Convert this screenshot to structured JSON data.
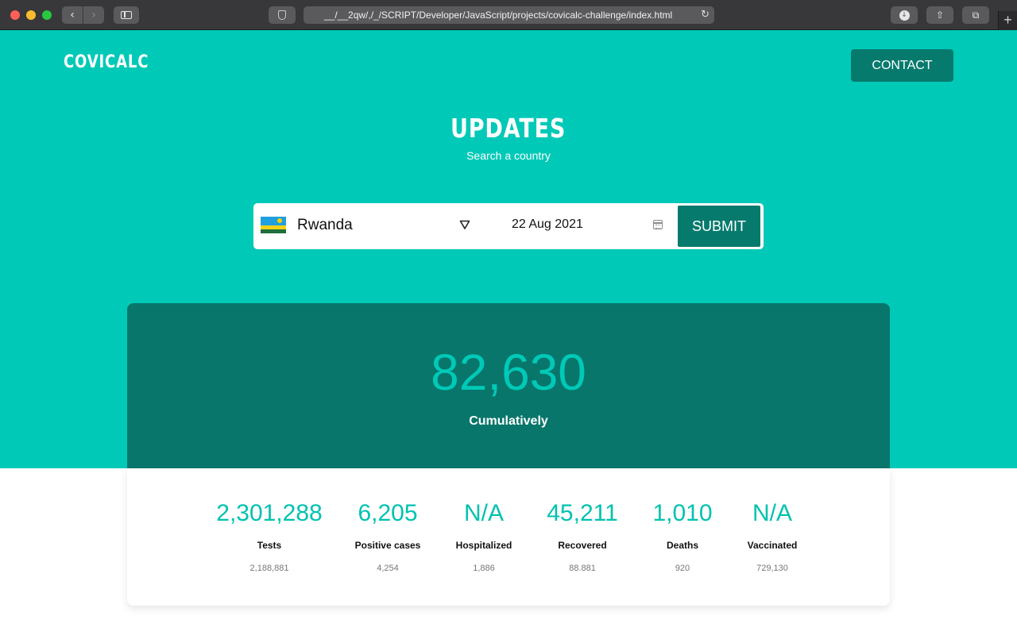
{
  "browser": {
    "url": "__/__2qw/,/_/SCRIPT/Developer/JavaScript/projects/covicalc-challenge/index.html",
    "icons": [
      "back-icon",
      "forward-icon",
      "sidebar-icon",
      "shield-icon",
      "reload-icon",
      "download-icon",
      "share-icon",
      "tabs-icon",
      "new-tab-icon"
    ]
  },
  "header": {
    "logo": "COVICALC",
    "contact_label": "CONTACT"
  },
  "hero": {
    "title": "UPDATES",
    "subtitle": "Search a country"
  },
  "search": {
    "country": "Rwanda",
    "date": "22 Aug 2021",
    "submit_label": "SUBMIT"
  },
  "summary": {
    "value": "82,630",
    "label": "Cumulatively"
  },
  "stats": [
    {
      "value": "2,301,288",
      "label": "Tests",
      "previous": "2,188,881"
    },
    {
      "value": "6,205",
      "label": "Positive cases",
      "previous": "4,254"
    },
    {
      "value": "N/A",
      "label": "Hospitalized",
      "previous": "1,886"
    },
    {
      "value": "45,211",
      "label": "Recovered",
      "previous": "88.881"
    },
    {
      "value": "1,010",
      "label": "Deaths",
      "previous": "920"
    },
    {
      "value": "N/A",
      "label": "Vaccinated",
      "previous": "729,130"
    }
  ],
  "colors": {
    "teal": "#00c9b7",
    "dark_teal": "#077a6e",
    "accent_text": "#00c2b0"
  }
}
